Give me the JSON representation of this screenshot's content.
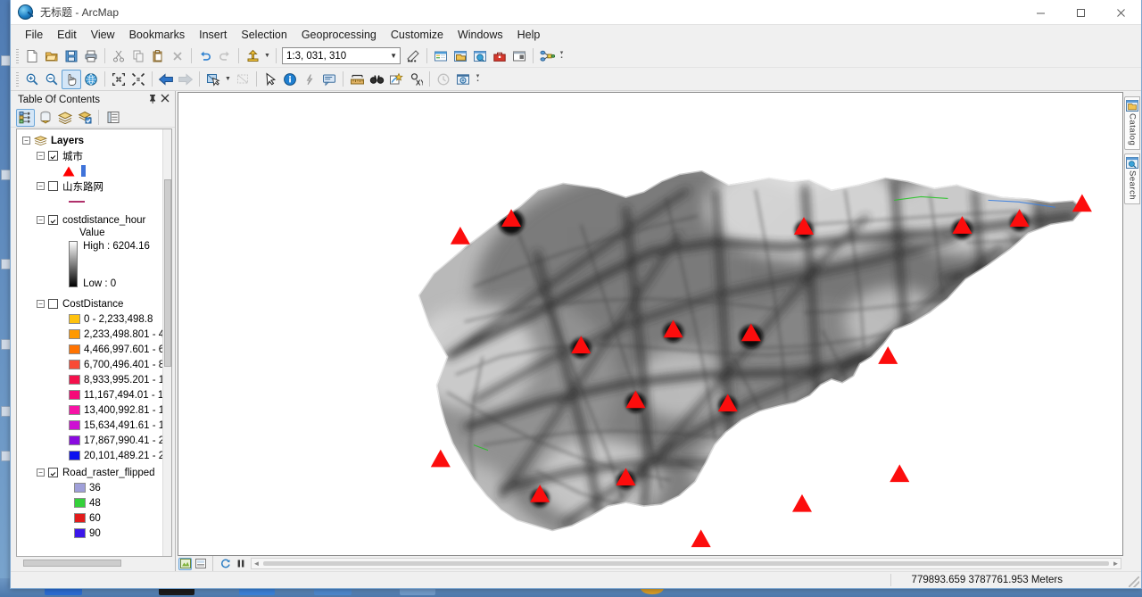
{
  "window": {
    "title": "无标题 - ArcMap",
    "app_icon": "arcmap-globe-icon",
    "minimize": "–",
    "maximize": "▢",
    "close": "✕"
  },
  "menubar": {
    "items": [
      {
        "label": "File"
      },
      {
        "label": "Edit"
      },
      {
        "label": "View"
      },
      {
        "label": "Bookmarks"
      },
      {
        "label": "Insert"
      },
      {
        "label": "Selection"
      },
      {
        "label": "Geoprocessing"
      },
      {
        "label": "Customize"
      },
      {
        "label": "Windows"
      },
      {
        "label": "Help"
      }
    ]
  },
  "standard_toolbar": {
    "scale": {
      "value": "1:3, 031, 310",
      "label": "Map Scale"
    },
    "buttons": [
      {
        "name": "new-map-icon",
        "tip": "New"
      },
      {
        "name": "open-icon",
        "tip": "Open"
      },
      {
        "name": "save-icon",
        "tip": "Save"
      },
      {
        "name": "print-icon",
        "tip": "Print"
      },
      {
        "name": "cut-icon",
        "tip": "Cut"
      },
      {
        "name": "copy-icon",
        "tip": "Copy"
      },
      {
        "name": "paste-icon",
        "tip": "Paste"
      },
      {
        "name": "delete-icon",
        "tip": "Delete"
      },
      {
        "name": "undo-icon",
        "tip": "Undo"
      },
      {
        "name": "redo-icon",
        "tip": "Redo"
      },
      {
        "name": "add-data-icon",
        "tip": "Add Data"
      },
      {
        "name": "editor-toolbar-icon",
        "tip": "Editor Toolbar"
      },
      {
        "name": "table-of-contents-icon",
        "tip": "Table Of Contents"
      },
      {
        "name": "catalog-window-icon",
        "tip": "Catalog Window"
      },
      {
        "name": "search-window-icon",
        "tip": "Search Window"
      },
      {
        "name": "arctoolbox-icon",
        "tip": "ArcToolbox"
      },
      {
        "name": "python-window-icon",
        "tip": "Python Window"
      },
      {
        "name": "modelbuilder-icon",
        "tip": "ModelBuilder"
      }
    ]
  },
  "tools_toolbar": {
    "buttons": [
      {
        "name": "zoom-in-icon",
        "tip": "Zoom In"
      },
      {
        "name": "zoom-out-icon",
        "tip": "Zoom Out"
      },
      {
        "name": "pan-icon",
        "tip": "Pan",
        "active": true
      },
      {
        "name": "full-extent-icon",
        "tip": "Full Extent"
      },
      {
        "name": "fixed-zoom-in-icon",
        "tip": "Fixed Zoom In"
      },
      {
        "name": "fixed-zoom-out-icon",
        "tip": "Fixed Zoom Out"
      },
      {
        "name": "back-extent-icon",
        "tip": "Go Back To Previous Extent"
      },
      {
        "name": "forward-extent-icon",
        "tip": "Go To Next Extent"
      },
      {
        "name": "select-features-icon",
        "tip": "Select Features"
      },
      {
        "name": "clear-selection-icon",
        "tip": "Clear Selected Features"
      },
      {
        "name": "select-elements-icon",
        "tip": "Select Elements"
      },
      {
        "name": "identify-icon",
        "tip": "Identify"
      },
      {
        "name": "hyperlink-icon",
        "tip": "Hyperlink"
      },
      {
        "name": "html-popup-icon",
        "tip": "HTML Popup"
      },
      {
        "name": "measure-icon",
        "tip": "Measure"
      },
      {
        "name": "find-icon",
        "tip": "Find"
      },
      {
        "name": "find-route-icon",
        "tip": "Find Route"
      },
      {
        "name": "go-to-xy-icon",
        "tip": "Go To XY"
      },
      {
        "name": "time-slider-icon",
        "tip": "Time Slider"
      },
      {
        "name": "create-viewer-icon",
        "tip": "Create Viewer Window"
      }
    ]
  },
  "toc": {
    "title": "Table Of Contents",
    "pin": "⊐",
    "close": "✕",
    "toolbar": [
      {
        "name": "list-by-drawing-order-icon",
        "selected": true
      },
      {
        "name": "list-by-source-icon",
        "selected": false
      },
      {
        "name": "list-by-visibility-icon",
        "selected": false
      },
      {
        "name": "list-by-selection-icon",
        "selected": false
      },
      {
        "name": "options-icon",
        "selected": false
      }
    ],
    "root": {
      "label": "Layers",
      "checked": true,
      "expanded": true
    },
    "layers": [
      {
        "name": "城市",
        "checked": true,
        "expanded": true,
        "symbols": [
          {
            "type": "triangle",
            "color": "#ff0000"
          },
          {
            "type": "rect",
            "color": "#3f73d9"
          }
        ]
      },
      {
        "name": "山东路网",
        "checked": false,
        "expanded": true,
        "symbols": [
          {
            "type": "line",
            "color": "#b0306b"
          }
        ]
      },
      {
        "name": "costdistance_hour",
        "checked": true,
        "expanded": true,
        "ramp": {
          "value_label": "Value",
          "high_label": "High : 6204.16",
          "low_label": "Low : 0",
          "high_color": "#ffffff",
          "low_color": "#000000"
        }
      },
      {
        "name": "CostDistance",
        "checked": false,
        "expanded": true,
        "classes": [
          {
            "label": "0 - 2,233,498.8",
            "color": "#ffc20e"
          },
          {
            "label": "2,233,498.801 - 4,",
            "color": "#ff9900"
          },
          {
            "label": "4,466,997.601 - 6,",
            "color": "#ff7300"
          },
          {
            "label": "6,700,496.401 - 8,",
            "color": "#f94a36"
          },
          {
            "label": "8,933,995.201 - 1",
            "color": "#f4104b"
          },
          {
            "label": "11,167,494.01 - 1",
            "color": "#f50a78"
          },
          {
            "label": "13,400,992.81 - 1",
            "color": "#f712a6"
          },
          {
            "label": "15,634,491.61 - 1",
            "color": "#cd0fd3"
          },
          {
            "label": "17,867,990.41 - 2",
            "color": "#8a0ae0"
          },
          {
            "label": "20,101,489.21 - 2",
            "color": "#0b11f0"
          }
        ]
      },
      {
        "name": "Road_raster_flipped",
        "checked": true,
        "expanded": true,
        "classes": [
          {
            "label": "36",
            "color": "#9f9fd9"
          },
          {
            "label": "48",
            "color": "#34d13a"
          },
          {
            "label": "60",
            "color": "#e21b1b"
          },
          {
            "label": "90",
            "color": "#3b16ea"
          }
        ]
      }
    ]
  },
  "map": {
    "data_view_button": "data-view-icon",
    "layout_view_button": "layout-view-icon",
    "refresh_button": "refresh-view-icon",
    "pause_button": "pause-drawing-icon",
    "scroll_left": "◄",
    "scroll_right": "►"
  },
  "dock": {
    "tabs": [
      {
        "label": "Catalog",
        "icon": "catalog-icon"
      },
      {
        "label": "Search",
        "icon": "search-icon"
      }
    ]
  },
  "statusbar": {
    "coordinates": "779893.659  3787761.953 Meters"
  }
}
